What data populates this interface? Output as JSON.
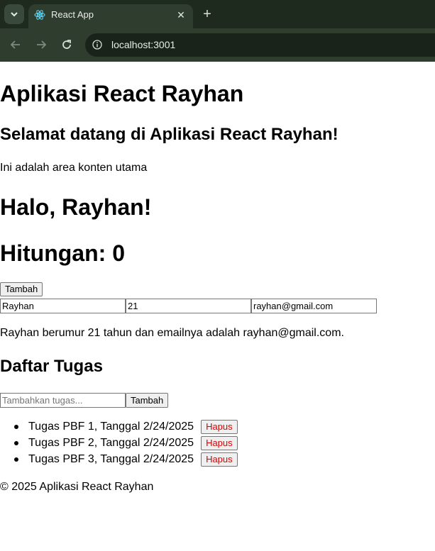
{
  "browser": {
    "tab_title": "React App",
    "url": "localhost:3001"
  },
  "page": {
    "app_title": "Aplikasi React Rayhan",
    "welcome": "Selamat datang di Aplikasi React Rayhan!",
    "content_text": "Ini adalah area konten utama",
    "greeting": "Halo, Rayhan!",
    "counter_text": "Hitungan: 0",
    "add_button": "Tambah",
    "form": {
      "name": "Rayhan",
      "age": "21",
      "email": "rayhan@gmail.com"
    },
    "summary": "Rayhan berumur 21 tahun dan emailnya adalah rayhan@gmail.com.",
    "tasks": {
      "title": "Daftar Tugas",
      "input_placeholder": "Tambahkan tugas...",
      "add_button": "Tambah",
      "delete_label": "Hapus",
      "items": [
        "Tugas PBF 1, Tanggal 2/24/2025",
        "Tugas PBF 2, Tanggal 2/24/2025",
        "Tugas PBF 3, Tanggal 2/24/2025"
      ]
    },
    "footer": "© 2025 Aplikasi React Rayhan"
  },
  "colors": {
    "delete_button_text": "#e00000",
    "chrome_dark": "#1f2a1f"
  }
}
